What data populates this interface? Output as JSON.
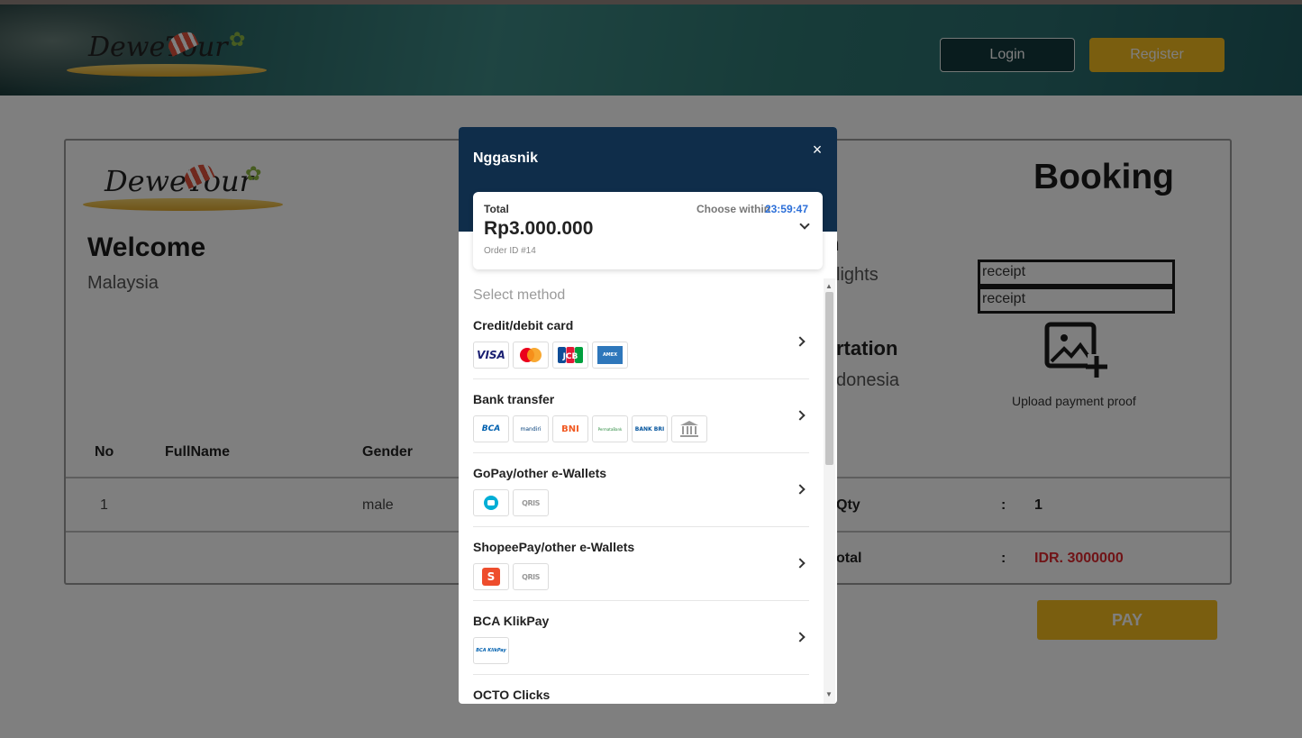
{
  "header": {
    "logo_text": "DeweTour",
    "login_label": "Login",
    "register_label": "Register"
  },
  "page": {
    "welcome": "Welcome",
    "country": "Malaysia",
    "booking_title": "Booking",
    "partial_heading_1": "n",
    "partial_text_1": "lights",
    "partial_heading_2": "rtation",
    "partial_text_2": "donesia",
    "receipt_1": "receipt",
    "receipt_2": "receipt",
    "upload_label": "Upload payment proof",
    "table": {
      "headers": [
        "No",
        "FullName",
        "Gender"
      ],
      "row": {
        "no": "1",
        "gender": "male"
      },
      "qty_label": "Qty",
      "qty_colon": ":",
      "qty_value": "1",
      "total_label": "otal",
      "total_colon": ":",
      "total_value": "IDR. 3000000"
    },
    "pay_label": "PAY"
  },
  "modal": {
    "merchant": "Nggasnik",
    "close": "×",
    "total_label": "Total",
    "choose_within": "Choose within",
    "timer": "23:59:47",
    "amount": "Rp3.000.000",
    "order_id": "Order ID #14",
    "select_method": "Select method",
    "methods": [
      {
        "name": "Credit/debit card",
        "logos": [
          "VISA",
          "mastercard",
          "JCB",
          "AMEX"
        ]
      },
      {
        "name": "Bank transfer",
        "logos": [
          "BCA",
          "mandiri",
          "BNI",
          "PermataBank",
          "BANK BRI",
          "other bank"
        ]
      },
      {
        "name": "GoPay/other e-Wallets",
        "logos": [
          "GoPay",
          "QRIS"
        ]
      },
      {
        "name": "ShopeePay/other e-Wallets",
        "logos": [
          "ShopeePay",
          "QRIS"
        ]
      },
      {
        "name": "BCA KlikPay",
        "logos": [
          "BCA KlikPay"
        ]
      },
      {
        "name": "OCTO Clicks",
        "logos": []
      }
    ]
  },
  "colors": {
    "accent_yellow": "#f5bd1f",
    "modal_header": "#0f2d4a",
    "timer_blue": "#2c6fd8",
    "total_red": "#e0282e"
  }
}
